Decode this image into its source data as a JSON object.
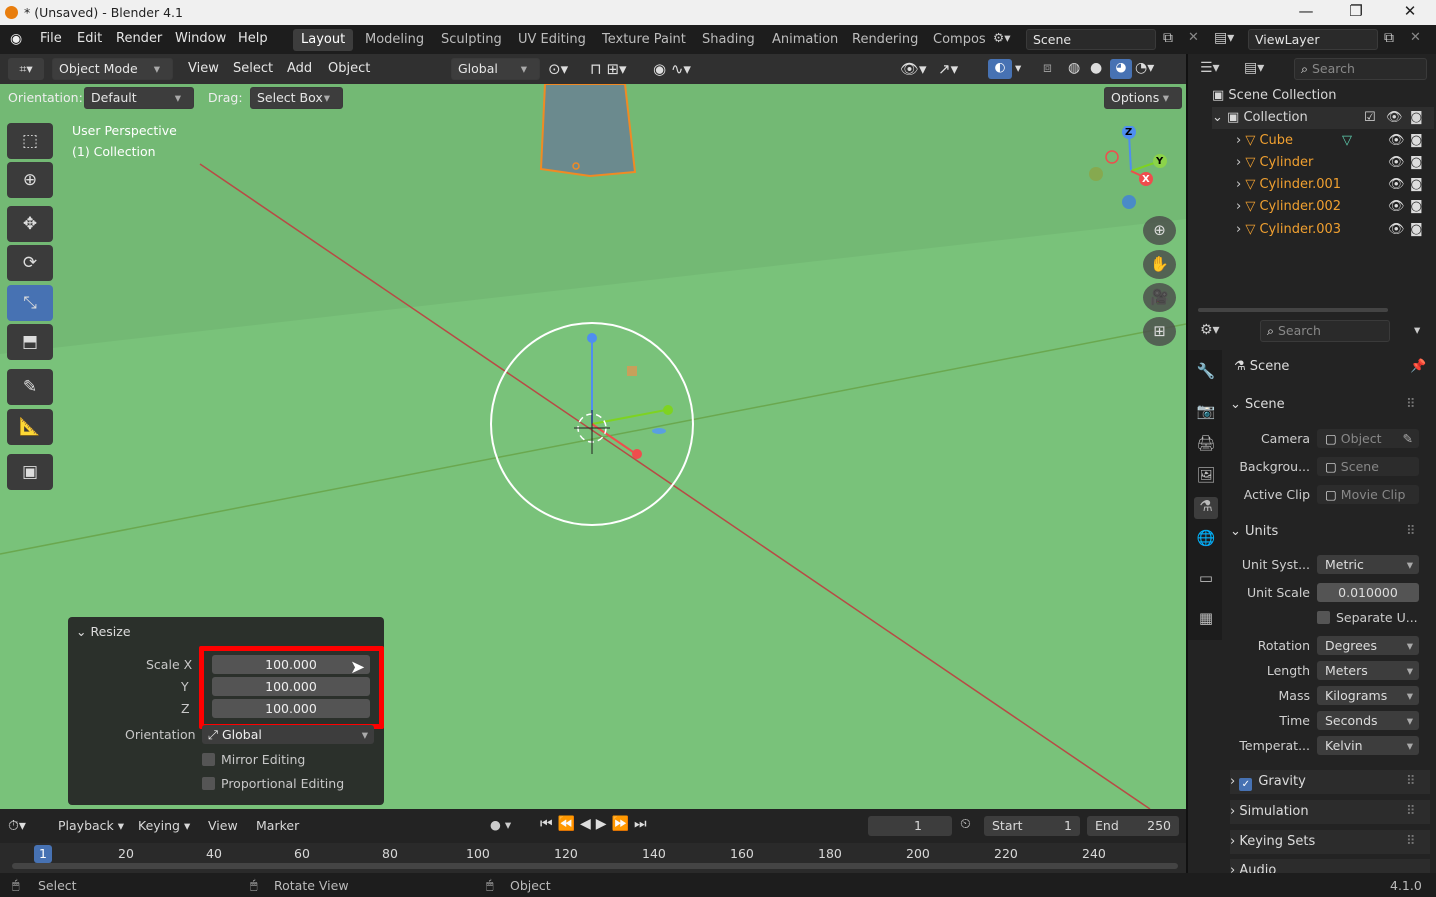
{
  "title": "* (Unsaved) - Blender 4.1",
  "window_controls": {
    "minimize": "—",
    "maximize": "❐",
    "close": "✕"
  },
  "menu": [
    "File",
    "Edit",
    "Render",
    "Window",
    "Help"
  ],
  "workspaces": [
    "Layout",
    "Modeling",
    "Sculpting",
    "UV Editing",
    "Texture Paint",
    "Shading",
    "Animation",
    "Rendering",
    "Compos"
  ],
  "scene": "Scene",
  "view_layer": "ViewLayer",
  "viewport_header": {
    "mode": "Object Mode",
    "menus": [
      "View",
      "Select",
      "Add",
      "Object"
    ],
    "transform": "Global",
    "orientation_label": "Orientation:",
    "orientation_value": "Default",
    "drag_label": "Drag:",
    "drag_value": "Select Box",
    "options": "Options"
  },
  "viewport": {
    "perspective": "User Perspective",
    "collection": "(1) Collection"
  },
  "gizmo": {
    "x": "X",
    "y": "Y",
    "z": "Z"
  },
  "resize_panel": {
    "title": "Resize",
    "scale_x_label": "Scale X",
    "scale_x": "100.000",
    "y_label": "Y",
    "y": "100.000",
    "z_label": "Z",
    "z": "100.000",
    "orientation_label": "Orientation",
    "orientation": "Global",
    "mirror": "Mirror Editing",
    "proportional": "Proportional Editing"
  },
  "timeline": {
    "menus": [
      "Playback",
      "Keying",
      "View",
      "Marker"
    ],
    "current_frame": "1",
    "start_label": "Start",
    "start": "1",
    "end_label": "End",
    "end": "250",
    "ruler": [
      "1",
      "20",
      "40",
      "60",
      "80",
      "100",
      "120",
      "140",
      "160",
      "180",
      "200",
      "220",
      "240"
    ]
  },
  "statusbar": {
    "select": "Select",
    "rotate": "Rotate View",
    "object": "Object",
    "version": "4.1.0"
  },
  "outliner": {
    "search_placeholder": "Search",
    "root": "Scene Collection",
    "collection": "Collection",
    "items": [
      "Cube",
      "Cylinder",
      "Cylinder.001",
      "Cylinder.002",
      "Cylinder.003"
    ]
  },
  "properties": {
    "search_placeholder": "Search",
    "context": "Scene",
    "scene_section": "Scene",
    "camera_label": "Camera",
    "camera": "Object",
    "background_label": "Backgrou...",
    "background": "Scene",
    "active_clip_label": "Active Clip",
    "active_clip": "Movie Clip",
    "units_section": "Units",
    "unit_system_label": "Unit Syst...",
    "unit_system": "Metric",
    "unit_scale_label": "Unit Scale",
    "unit_scale": "0.010000",
    "separate_units": "Separate U...",
    "rotation_label": "Rotation",
    "rotation": "Degrees",
    "length_label": "Length",
    "length": "Meters",
    "mass_label": "Mass",
    "mass": "Kilograms",
    "time_label": "Time",
    "time": "Seconds",
    "temperature_label": "Temperat...",
    "temperature": "Kelvin",
    "gravity": "Gravity",
    "simulation": "Simulation",
    "keying_sets": "Keying Sets",
    "audio": "Audio"
  },
  "colors": {
    "viewport_bg": "#79c27a",
    "highlight": "#ff0000",
    "active_blue": "#4772b3",
    "selected_orange": "#f0a030"
  }
}
